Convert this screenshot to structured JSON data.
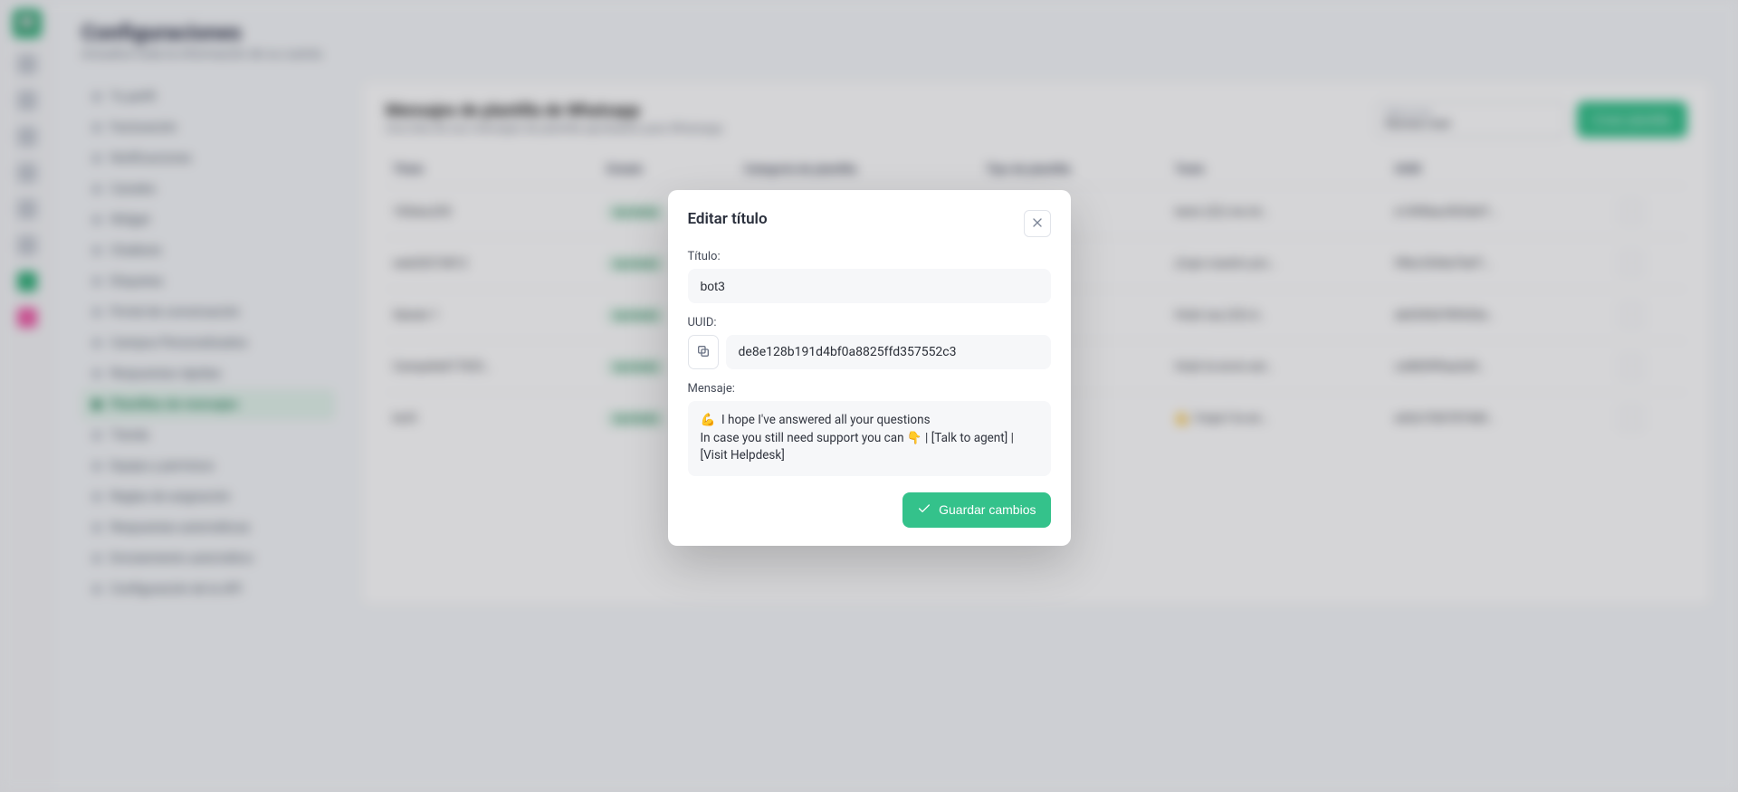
{
  "page": {
    "title": "Configuraciones",
    "subtitle": "Actualice toda la información de su cuenta"
  },
  "rail": {
    "logo_glyph": "💬"
  },
  "settings_nav": [
    {
      "label": "Tu perfil"
    },
    {
      "label": "Facturación"
    },
    {
      "label": "Notificaciones"
    },
    {
      "label": "Canales"
    },
    {
      "label": "Widget"
    },
    {
      "label": "Chatbots"
    },
    {
      "label": "Etiquetas"
    },
    {
      "label": "Portal de conversación"
    },
    {
      "label": "Campos Personalizados"
    },
    {
      "label": "Respuestas rápidas"
    },
    {
      "label": "Plantillas de mensajes",
      "active": true
    },
    {
      "label": "Tienda"
    },
    {
      "label": "Equipo y permisos"
    },
    {
      "label": "Reglas de asignación"
    },
    {
      "label": "Respuestas automáticas"
    },
    {
      "label": "Enrutamiento automático"
    },
    {
      "label": "Configuración de la API"
    }
  ],
  "content": {
    "title": "Mensajes de plantilla de Whatsapp",
    "subtitle": "Una lista de sus mensajes de plantilla aprobados para Whatsapp",
    "select_small": "Seleccionar",
    "select_value": "Número test",
    "create_button": "Crear plantilla",
    "columns": {
      "titulo": "Título",
      "estado": "Estado",
      "categoria": "Categoría de plantilla",
      "tipo": "Tipo de plantilla",
      "texto": "Texto",
      "uuid": "UUID"
    },
    "rows": [
      {
        "titulo": "100sku255",
        "estado": "Aprobada",
        "categoria": "",
        "tipo": "",
        "texto": "texto (22) me int…",
        "uuid": "e1499bac9034ef1…"
      },
      {
        "titulo": "web20210812",
        "estado": "Aprobada",
        "categoria": "",
        "tipo": "",
        "texto": "¡Cupo nuestro pro…",
        "uuid": "99bc3344a76ef1…"
      },
      {
        "titulo": "Saludo 1",
        "estado": "Aprobada",
        "categoria": "",
        "tipo": "",
        "texto": "Hola! soy (22) d…",
        "uuid": "ab6545d789543e…"
      },
      {
        "titulo": "Campaña017025…",
        "estado": "Aprobada",
        "categoria": "",
        "tipo": "",
        "texto": "Hola! te envío est…",
        "uuid": "cd4839f9aa2d4…"
      },
      {
        "titulo": "bot3",
        "estado": "Aprobada",
        "categoria": "",
        "tipo": "",
        "texto": "💪 I hope I've an…",
        "uuid": "ed2a15367874d0…"
      }
    ]
  },
  "modal": {
    "heading": "Editar título",
    "titulo_label": "Título:",
    "titulo_value": "bot3",
    "uuid_label": "UUID:",
    "uuid_value": "de8e128b191d4bf0a8825ffd357552c3",
    "mensaje_label": "Mensaje:",
    "mensaje_value": "💪  I hope I've answered all your questions\nIn case you still need support you can 👇 | [Talk to agent] | [Visit Helpdesk]",
    "save_label": "Guardar cambios"
  }
}
